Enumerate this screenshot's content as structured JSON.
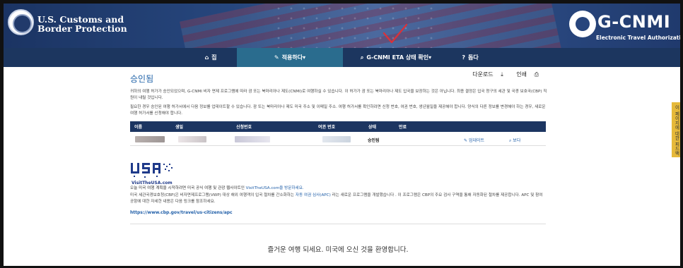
{
  "header": {
    "agency_line1": "U.S. Customs and",
    "agency_line2": "Border Protection",
    "logo_text": "G-CNMI",
    "logo_subtitle": "Electronic Travel Authorization"
  },
  "nav": {
    "items": [
      {
        "icon": "home-icon",
        "label": "집"
      },
      {
        "icon": "pencil-icon",
        "label": "적용하다"
      },
      {
        "icon": "search-icon",
        "label": "G-CNMI ETA 상태 확인"
      },
      {
        "icon": "help-icon",
        "label": "돕다"
      }
    ]
  },
  "page": {
    "title": "승인됨",
    "download_label": "다운로드",
    "print_label": "인쇄",
    "paragraph1": "귀하의 여행 허가가 승인되었으며, G-CNMI 비자 면제 프로그램에 따라 괌 또는 북마리아나 제도(CNMI)로 여행하실 수 있습니다. 이 허가가 괌 또는 북마리아나 제도 입국을 보장하는 것은 아닙니다. 최종 결정은 입국 청구의 세관 및 국경 보호국(CBP) 직원이 내릴 것입니다.",
    "paragraph2": "필요한 경우 승인된 여행 허가서에서 다음 정보를 업데이트할 수 있습니다. 괌 또는 북마리아나 제도 미국 주소 및 이메일 주소. 여행 허가서를 확인하려면 신청 번호, 여권 번호, 생년월일을 제공해야 합니다. 양식의 다른 정보를 변경해야 하는 경우, 새로운 여행 허가서를 신청해야 합니다."
  },
  "table": {
    "headers": [
      "이름",
      "생일",
      "신청번호",
      "여권 번호",
      "상태",
      "만료"
    ],
    "row": {
      "status": "승인됨",
      "update_label": "업데이트",
      "view_label": "보다"
    }
  },
  "footer": {
    "usa_logo_text": "VisitTheUSA.com",
    "visit_text": "오늘 미국 여행 계획을 시작하려면 미국 공식 여행 및 관광 웹사이트인 ",
    "visit_link": "VisitTheUSA.com을 방문하세요.",
    "apc_text1": "미국 세관국경보호청(CBP)은 비자면제프로그램(VWP) 대상 해외 여행객의 입국 절차를 간소화하는 ",
    "apc_link": "자동 여권 심사(APC)",
    "apc_text2": " 라는 새로운 프로그램을 개발했습니다 . 이 프로그램은 CBP의 주요 검사 구역을 통해 자동화된 절차를 제공합니다. APC 및 참여 공항에 대한 자세한 내용은 다음 링크를 참조하세요.",
    "url": "https://www.cbp.gov/travel/us-citizens/apc",
    "farewell": "즐거운 여행 되세요. 미국에 오신 것을 환영합니다."
  },
  "side_tab": {
    "label": "이 페이지에 대한 피드백"
  },
  "colors": {
    "nav_bg": "#1c365f",
    "nav_active": "#2a6c8e",
    "table_header": "#1c3561",
    "link": "#1f5ea8",
    "title": "#1f62a8",
    "check_red": "#d8323a",
    "side_tab": "#e6b93a"
  }
}
